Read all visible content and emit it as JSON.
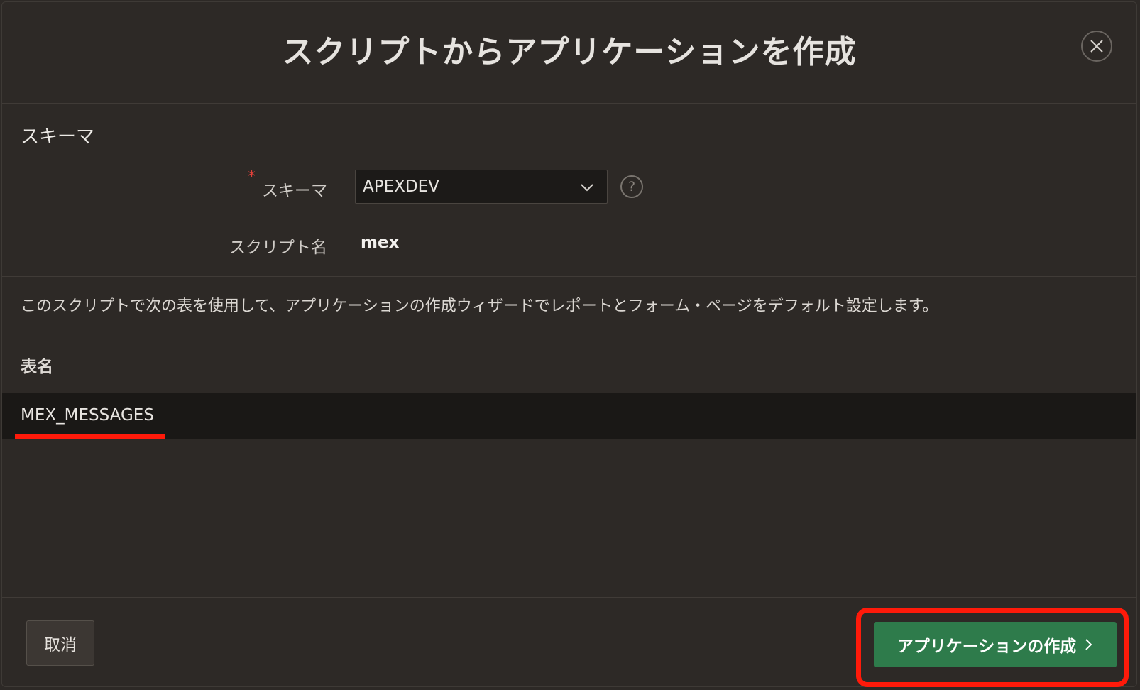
{
  "dialog": {
    "title": "スクリプトからアプリケーションを作成",
    "close_icon": "close-icon"
  },
  "region": {
    "title": "スキーマ"
  },
  "form": {
    "schema_label": "スキーマ",
    "schema_required_mark": "*",
    "schema_value": "APEXDEV",
    "help_glyph": "?",
    "script_name_label": "スクリプト名",
    "script_name_value": "mex"
  },
  "description": "このスクリプトで次の表を使用して、アプリケーションの作成ウィザードでレポートとフォーム・ページをデフォルト設定します。",
  "table": {
    "header": "表名",
    "rows": [
      "MEX_MESSAGES"
    ]
  },
  "footer": {
    "cancel_label": "取消",
    "create_label": "アプリケーションの作成"
  },
  "colors": {
    "background": "#2d2926",
    "primary_button": "#2e7b4b",
    "annotation_red": "#ff1a0a",
    "required_mark": "#e0413a"
  }
}
